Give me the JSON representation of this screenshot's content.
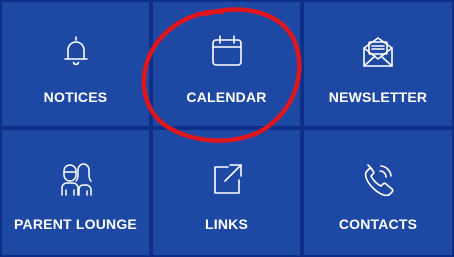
{
  "tiles": [
    {
      "label": "NOTICES",
      "icon": "bell-icon"
    },
    {
      "label": "CALENDAR",
      "icon": "calendar-icon"
    },
    {
      "label": "NEWSLETTER",
      "icon": "envelope-letter-icon"
    },
    {
      "label": "PARENT LOUNGE",
      "icon": "people-icon"
    },
    {
      "label": "LINKS",
      "icon": "external-link-icon"
    },
    {
      "label": "CONTACTS",
      "icon": "phone-icon"
    }
  ],
  "colors": {
    "tile_background": "#1d48a3",
    "grid_lines": "#0e2f87",
    "text": "#ffffff",
    "annotation_circle": "#e0161c"
  }
}
